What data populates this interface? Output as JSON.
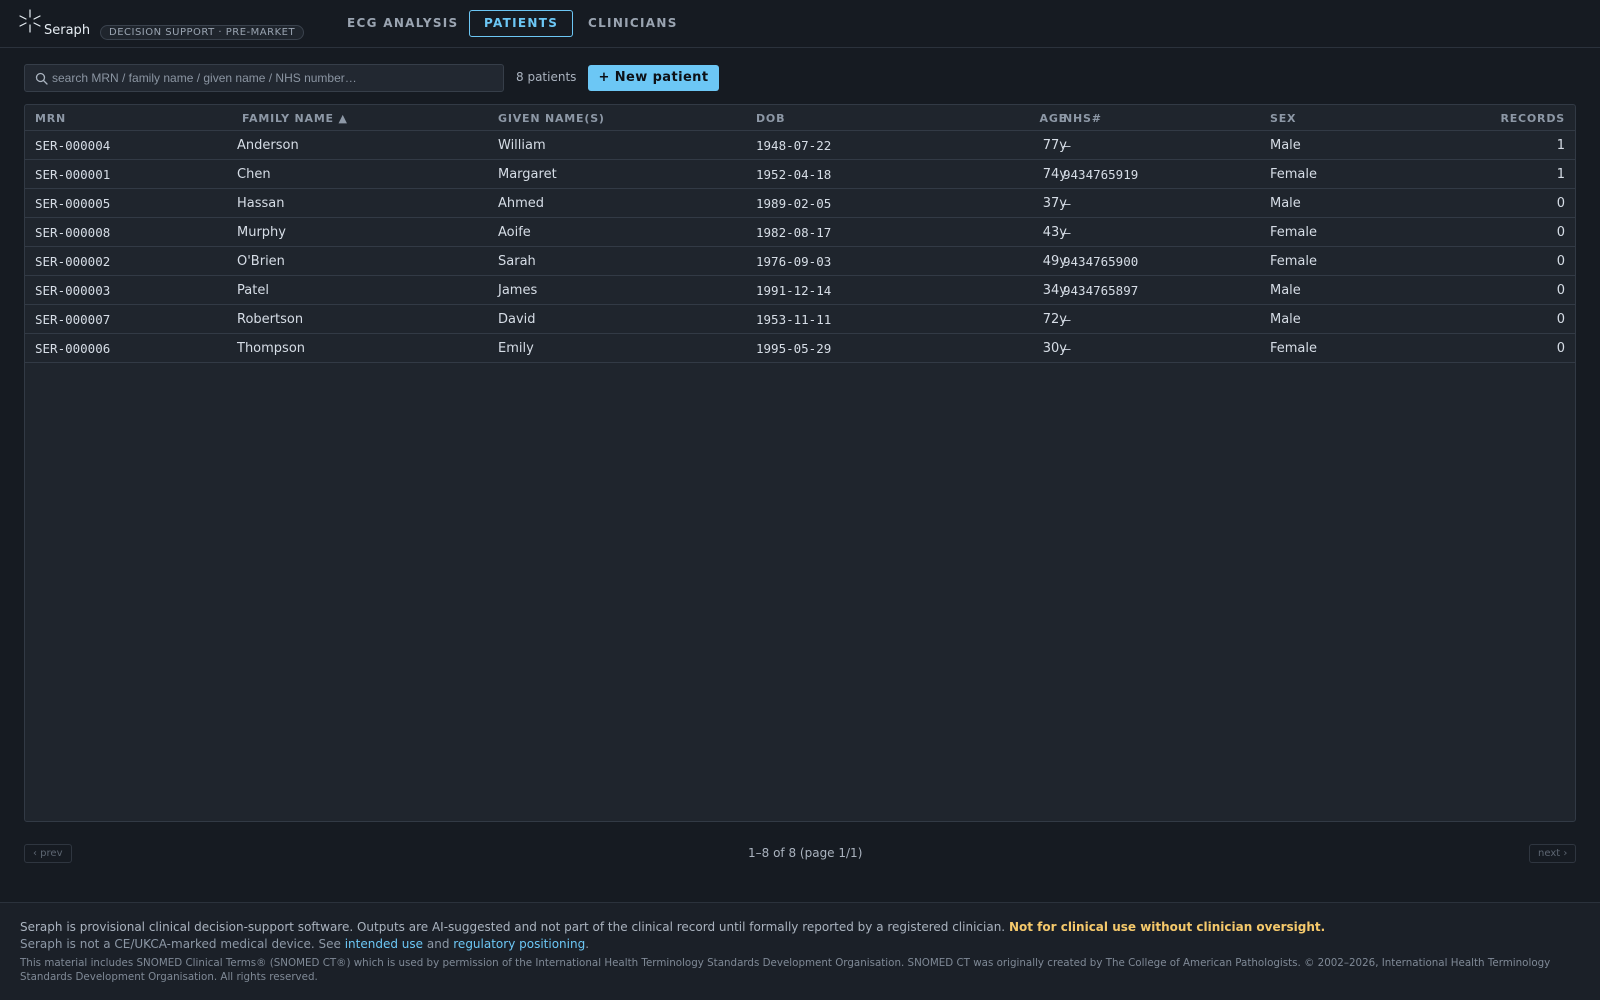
{
  "header": {
    "brand": "Seraph",
    "badge": "DECISION SUPPORT · PRE-MARKET",
    "tabs": [
      {
        "label": "ECG ANALYSIS",
        "active": false
      },
      {
        "label": "PATIENTS",
        "active": true
      },
      {
        "label": "CLINICIANS",
        "active": false
      }
    ]
  },
  "toolbar": {
    "search_placeholder": "search MRN / family name / given name / NHS number…",
    "search_value": "",
    "count_label": "8 patients",
    "new_patient_label": "+ New patient"
  },
  "table": {
    "columns": [
      "MRN",
      "FAMILY NAME ▲",
      "GIVEN NAME(S)",
      "DOB",
      "AGE",
      "NHS#",
      "SEX",
      "RECORDS"
    ],
    "rows": [
      {
        "mrn": "SER-000004",
        "family": "Anderson",
        "given": "William",
        "dob": "1948-07-22",
        "age": "77y",
        "nhs": "–",
        "sex": "Male",
        "records": "1"
      },
      {
        "mrn": "SER-000001",
        "family": "Chen",
        "given": "Margaret",
        "dob": "1952-04-18",
        "age": "74y",
        "nhs": "9434765919",
        "sex": "Female",
        "records": "1"
      },
      {
        "mrn": "SER-000005",
        "family": "Hassan",
        "given": "Ahmed",
        "dob": "1989-02-05",
        "age": "37y",
        "nhs": "–",
        "sex": "Male",
        "records": "0"
      },
      {
        "mrn": "SER-000008",
        "family": "Murphy",
        "given": "Aoife",
        "dob": "1982-08-17",
        "age": "43y",
        "nhs": "–",
        "sex": "Female",
        "records": "0"
      },
      {
        "mrn": "SER-000002",
        "family": "O'Brien",
        "given": "Sarah",
        "dob": "1976-09-03",
        "age": "49y",
        "nhs": "9434765900",
        "sex": "Female",
        "records": "0"
      },
      {
        "mrn": "SER-000003",
        "family": "Patel",
        "given": "James",
        "dob": "1991-12-14",
        "age": "34y",
        "nhs": "9434765897",
        "sex": "Male",
        "records": "0"
      },
      {
        "mrn": "SER-000007",
        "family": "Robertson",
        "given": "David",
        "dob": "1953-11-11",
        "age": "72y",
        "nhs": "–",
        "sex": "Male",
        "records": "0"
      },
      {
        "mrn": "SER-000006",
        "family": "Thompson",
        "given": "Emily",
        "dob": "1995-05-29",
        "age": "30y",
        "nhs": "–",
        "sex": "Female",
        "records": "0"
      }
    ]
  },
  "pager": {
    "prev_label": "‹ prev",
    "next_label": "next ›",
    "status": "1–8 of 8 (page 1/1)"
  },
  "footer": {
    "line1": "Seraph is provisional clinical decision-support software. Outputs are AI-suggested and not part of the clinical record until formally reported by a registered clinician.",
    "line1_warning": "Not for clinical use without clinician oversight.",
    "line2_prefix": "Seraph is not a CE/UKCA-marked medical device. See",
    "line2_link1": "intended use",
    "line2_and": "and",
    "line2_link2": "regulatory positioning",
    "line2_suffix": ".",
    "line3": "This material includes SNOMED Clinical Terms® (SNOMED CT®) which is used by permission of the International Health Terminology Standards Development Organisation. SNOMED CT was originally created by The College of American Pathologists. © 2002–2026, International Health Terminology Standards Development Organisation. All rights reserved."
  },
  "colors": {
    "accent": "#6cc7f5",
    "warning": "#f5c96b",
    "background": "#161b22",
    "panel": "#1f252d"
  },
  "icons": [
    "seraph-logo-icon",
    "search-icon"
  ]
}
